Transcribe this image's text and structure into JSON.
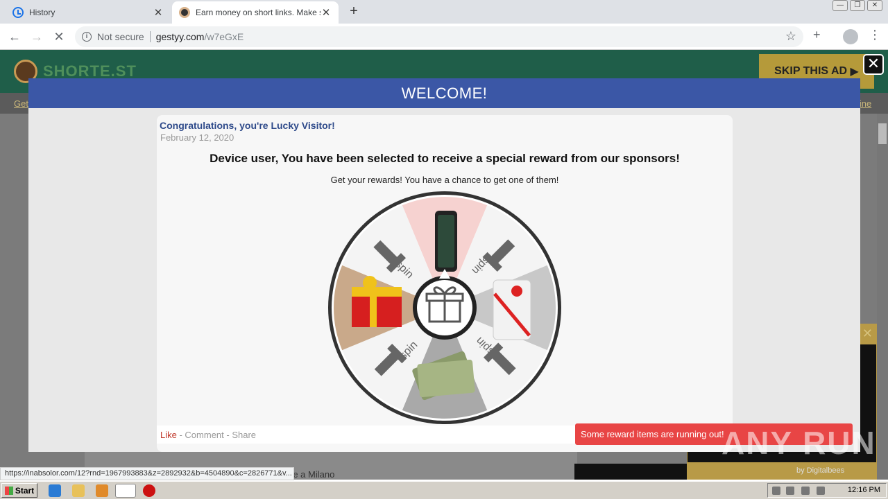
{
  "browser": {
    "tabs": [
      {
        "title": "History",
        "icon": "history-icon"
      },
      {
        "title": "Earn money on short links. Make sho",
        "icon": "shortest-favicon"
      }
    ],
    "security_label": "Not secure",
    "url_host": "gestyy.com",
    "url_path": "/w7eGxE"
  },
  "site": {
    "logo_text": "SHORTE.ST",
    "skip_label": "SKIP THIS AD",
    "subnav_left": "Get",
    "subnav_right": "line",
    "bg_text": "re a Milano",
    "ad_by": "by Digitalbees"
  },
  "modal": {
    "header": "WELCOME!",
    "card_title": "Congratulations, you're Lucky Visitor!",
    "date": "February 12, 2020",
    "headline": "Device user, You have been selected to receive a special reward from our sponsors!",
    "subtext": "Get your rewards! You have a chance to get one of them!",
    "wheel_segments": [
      "phone",
      "1 spin",
      "gift box",
      "1 spin",
      "cash",
      "1 spin",
      "gift bag",
      "1 spin"
    ],
    "spin_label": "spin",
    "footer": {
      "like": "Like",
      "comment": "Comment",
      "share": "Share",
      "sep": " - "
    }
  },
  "toast": "Some reward items are running out!",
  "watermark": "ANY RUN",
  "status_url": "https://inabsolor.com/12?rnd=1967993883&z=2892932&b=4504890&c=2826771&v...",
  "taskbar": {
    "start": "Start",
    "clock": "12:16 PM"
  }
}
